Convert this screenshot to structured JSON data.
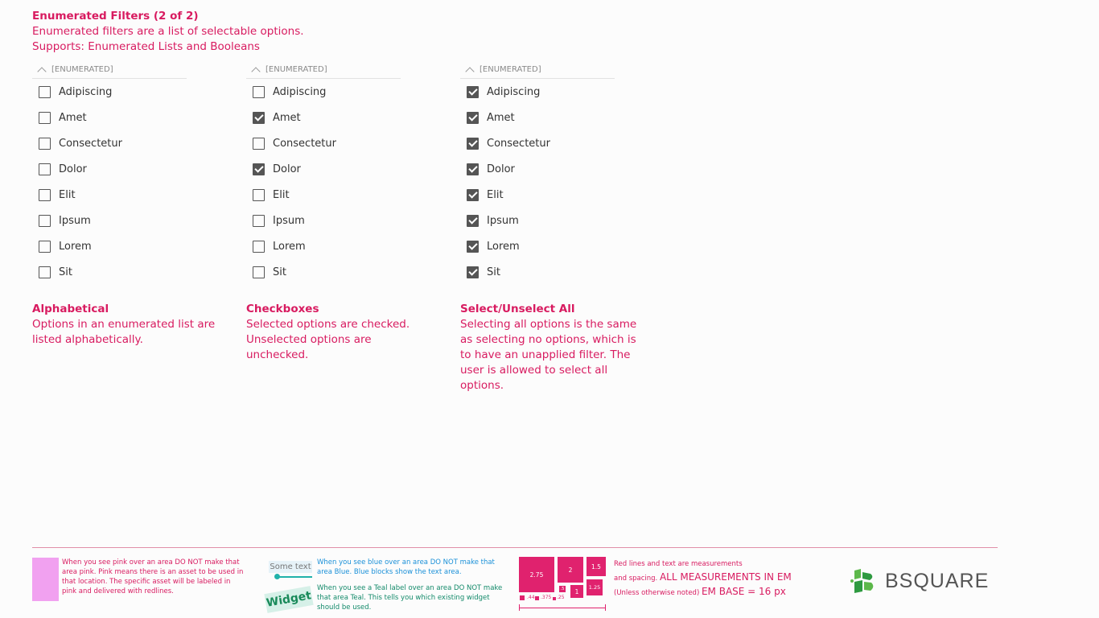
{
  "header": {
    "title": "Enumerated Filters (2 of 2)",
    "line1": "Enumerated filters are a list of selectable options.",
    "line2": "Supports: Enumerated Lists and Booleans"
  },
  "filters": [
    {
      "header_label": "[ENUMERATED]",
      "options": [
        {
          "label": "Adipiscing",
          "checked": false
        },
        {
          "label": "Amet",
          "checked": false
        },
        {
          "label": "Consectetur",
          "checked": false
        },
        {
          "label": "Dolor",
          "checked": false
        },
        {
          "label": "Elit",
          "checked": false
        },
        {
          "label": "Ipsum",
          "checked": false
        },
        {
          "label": "Lorem",
          "checked": false
        },
        {
          "label": "Sit",
          "checked": false
        }
      ]
    },
    {
      "header_label": "[ENUMERATED]",
      "options": [
        {
          "label": "Adipiscing",
          "checked": false
        },
        {
          "label": "Amet",
          "checked": true
        },
        {
          "label": "Consectetur",
          "checked": false
        },
        {
          "label": "Dolor",
          "checked": true
        },
        {
          "label": "Elit",
          "checked": false
        },
        {
          "label": "Ipsum",
          "checked": false
        },
        {
          "label": "Lorem",
          "checked": false
        },
        {
          "label": "Sit",
          "checked": false
        }
      ]
    },
    {
      "header_label": "[ENUMERATED]",
      "options": [
        {
          "label": "Adipiscing",
          "checked": true
        },
        {
          "label": "Amet",
          "checked": true
        },
        {
          "label": "Consectetur",
          "checked": true
        },
        {
          "label": "Dolor",
          "checked": true
        },
        {
          "label": "Elit",
          "checked": true
        },
        {
          "label": "Ipsum",
          "checked": true
        },
        {
          "label": "Lorem",
          "checked": true
        },
        {
          "label": "Sit",
          "checked": true
        }
      ]
    }
  ],
  "notes": [
    {
      "title": "Alphabetical",
      "body": "Options in an enumerated list are listed alphabetically."
    },
    {
      "title": "Checkboxes",
      "body": "Selected options are checked. Unselected options are unchecked."
    },
    {
      "title": "Select/Unselect All",
      "body": "Selecting all options is the same as selecting no options, which is to have an unapplied filter. The user is allowed to select all options."
    }
  ],
  "legend": {
    "pink_text": "When you see pink over an area DO NOT make that area pink. Pink means there is an asset to be used in that location. The specific asset will be labeled in pink and delivered with redlines.",
    "some_text": "Some text",
    "blue_text": "When you see blue over an area DO NOT make that area Blue. Blue blocks show the text area.",
    "widget_label": "Widget",
    "teal_text": "When you see a Teal label over an area DO NOT make that area Teal. This tells you which existing widget should be used.",
    "squares": [
      "2.75",
      "2",
      "1.5",
      ".5",
      "1",
      "1.25",
      ".44",
      ".375",
      ".25"
    ],
    "measure_line1": "Red lines and text are measurements",
    "measure_line2a": "and spacing.",
    "measure_line2b": "ALL MEASUREMENTS IN EM",
    "measure_line3a": "(Unless otherwise noted)",
    "measure_line3b": "EM BASE = 16 px",
    "colors": {
      "pink": "#d81b60",
      "blue": "#1a90d8",
      "teal": "#138a6a"
    }
  },
  "logo": {
    "word": "BSQUARE",
    "icon": "bsquare-logo-icon"
  }
}
